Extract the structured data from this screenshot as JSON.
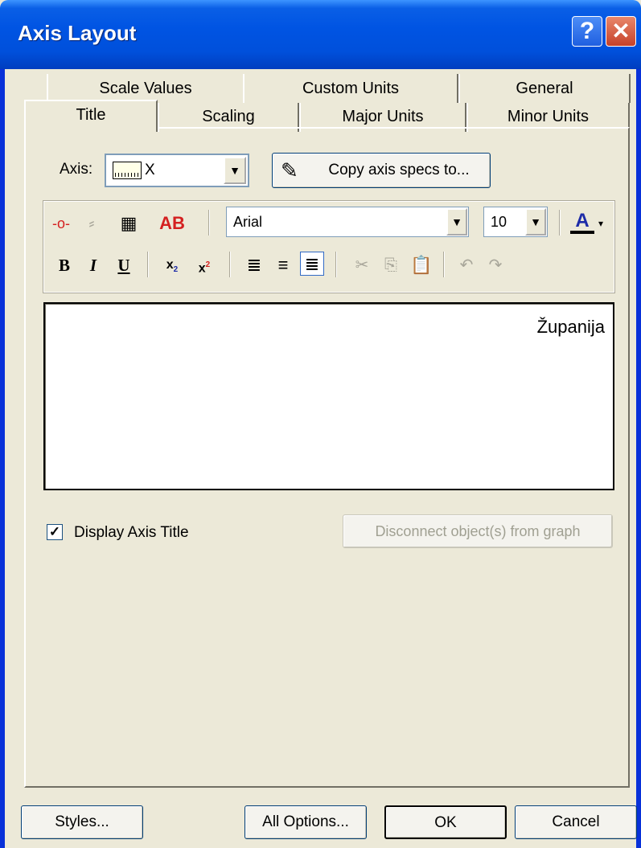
{
  "window": {
    "title": "Axis Layout",
    "help_label": "?",
    "close_label": "✕"
  },
  "tabs": {
    "row_back": [
      "Scale Values",
      "Custom Units",
      "General"
    ],
    "row_front": [
      "Title",
      "Scaling",
      "Major Units",
      "Minor Units"
    ],
    "active": "Title"
  },
  "axis": {
    "label": "Axis:",
    "value": "X",
    "copy_button": "Copy axis specs to..."
  },
  "toolbar": {
    "font": "Arial",
    "size": "10",
    "icons_row1": [
      "marker-icon",
      "symbol-icon",
      "table-icon",
      "text-style-icon",
      "font-color-icon"
    ],
    "icons_row2": [
      "bold",
      "italic",
      "underline",
      "subscript",
      "superscript",
      "align-left",
      "align-center",
      "align-right",
      "cut",
      "copy",
      "paste",
      "undo",
      "redo"
    ],
    "bold_label": "B",
    "italic_label": "I",
    "underline_label": "U",
    "text_style_label": "AB",
    "font_color_label": "A"
  },
  "text_area": {
    "content": "Županija"
  },
  "display_title": {
    "label": "Display Axis Title",
    "checked": true
  },
  "disconnect_button": "Disconnect object(s) from graph",
  "footer": {
    "styles": "Styles...",
    "all_options": "All Options...",
    "ok": "OK",
    "cancel": "Cancel"
  }
}
